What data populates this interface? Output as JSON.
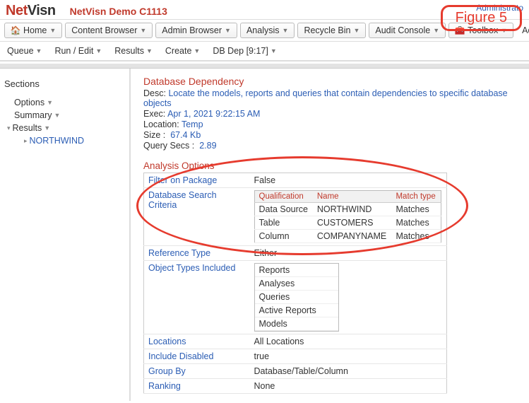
{
  "header": {
    "logo_net": "Net",
    "logo_visn": "Visn",
    "demo_title": "NetVisn Demo C1113",
    "admin_link": "Administrato",
    "figure_label": "Figure 5"
  },
  "toolbar": [
    {
      "icon": "🏠",
      "label": "Home"
    },
    {
      "icon": "",
      "label": "Content Browser"
    },
    {
      "icon": "",
      "label": "Admin Browser"
    },
    {
      "icon": "",
      "label": "Analysis"
    },
    {
      "icon": "",
      "label": "Recycle Bin"
    },
    {
      "icon": "",
      "label": "Audit Console"
    },
    {
      "icon": "🧰",
      "label": "Toolbox"
    },
    {
      "icon": "",
      "label": "Adminis"
    }
  ],
  "subbar": [
    "Queue",
    "Run / Edit",
    "Results",
    "Create",
    "DB Dep [9:17]"
  ],
  "sidebar": {
    "title": "Sections",
    "items": [
      {
        "label": "Options",
        "caret": true,
        "link": false,
        "toggle": ""
      },
      {
        "label": "Summary",
        "caret": true,
        "link": false,
        "toggle": ""
      },
      {
        "label": "Results",
        "caret": true,
        "link": false,
        "toggle": "▾"
      },
      {
        "label": "NORTHWIND",
        "caret": false,
        "link": true,
        "sub": true,
        "toggle": "▸"
      }
    ]
  },
  "main": {
    "title": "Database Dependency",
    "desc_label": "Desc:",
    "desc_value": "Locate the models, reports and queries that contain dependencies to specific database objects",
    "exec_label": "Exec:",
    "exec_value": "Apr 1, 2021 9:22:15 AM",
    "location_label": "Location:",
    "location_value": "Temp",
    "size_label": "Size :",
    "size_value": "67.4 Kb",
    "qsecs_label": "Query Secs :",
    "qsecs_value": "2.89",
    "analysis_title": "Analysis Options",
    "props": {
      "filter_on_package": {
        "k": "Filter on Package",
        "v": "False"
      },
      "db_search_criteria": {
        "k": "Database Search Criteria"
      },
      "criteria_headers": [
        "Qualification",
        "Name",
        "Match type"
      ],
      "criteria_rows": [
        [
          "Data Source",
          "NORTHWIND",
          "Matches"
        ],
        [
          "Table",
          "CUSTOMERS",
          "Matches"
        ],
        [
          "Column",
          "COMPANYNAME",
          "Matches"
        ]
      ],
      "ref_type": {
        "k": "Reference Type",
        "v": "Either"
      },
      "obj_types": {
        "k": "Object Types Included",
        "list": [
          "Reports",
          "Analyses",
          "Queries",
          "Active Reports",
          "Models"
        ]
      },
      "locations": {
        "k": "Locations",
        "v": "All Locations"
      },
      "include_disabled": {
        "k": "Include Disabled",
        "v": "true"
      },
      "group_by": {
        "k": "Group By",
        "v": "Database/Table/Column"
      },
      "ranking": {
        "k": "Ranking",
        "v": "None"
      }
    }
  }
}
